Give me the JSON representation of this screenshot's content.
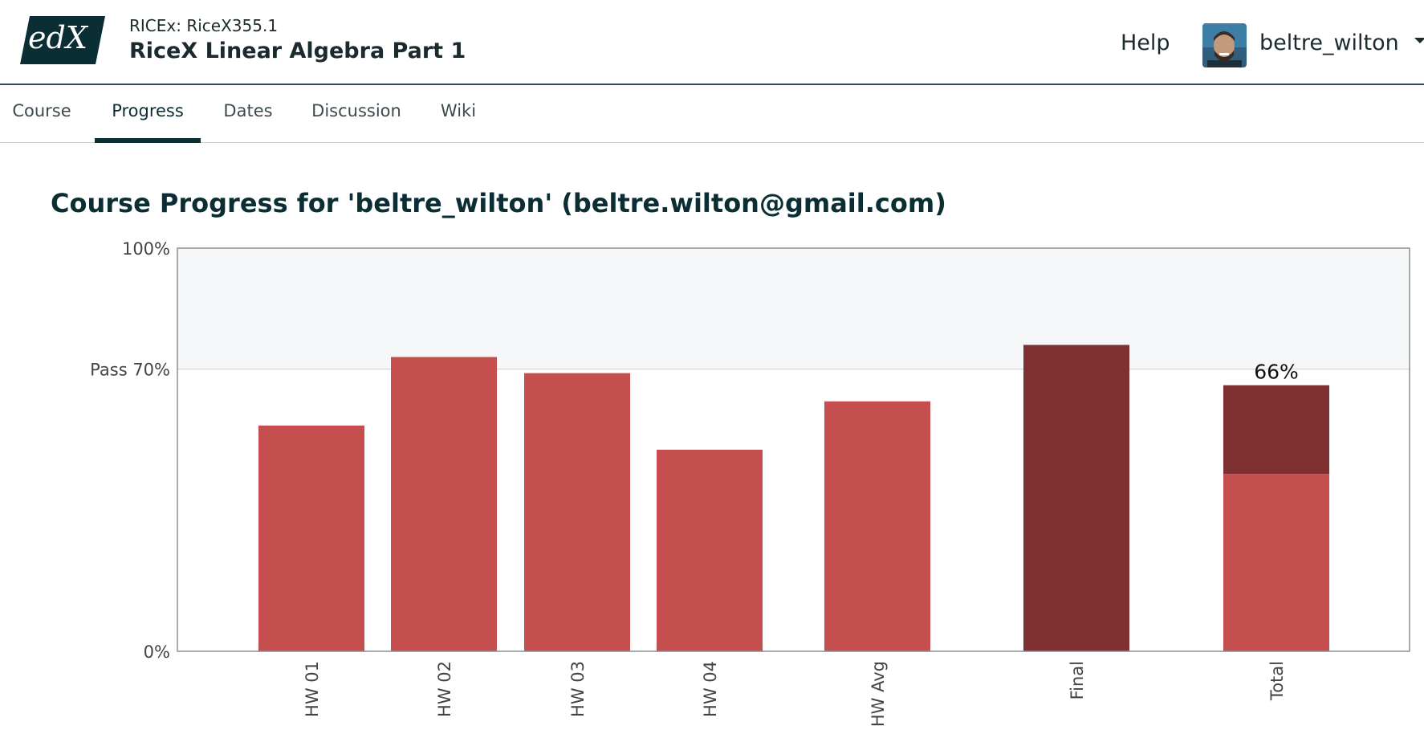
{
  "course": {
    "org_line": "RICEx: RiceX355.1",
    "title": "RiceX Linear Algebra Part 1"
  },
  "header": {
    "logo_text": "edX",
    "help_label": "Help",
    "username": "beltre_wilton"
  },
  "tabs": [
    {
      "label": "Course",
      "active": false
    },
    {
      "label": "Progress",
      "active": true
    },
    {
      "label": "Dates",
      "active": false
    },
    {
      "label": "Discussion",
      "active": false
    },
    {
      "label": "Wiki",
      "active": false
    }
  ],
  "page_title": "Course Progress for 'beltre_wilton' (beltre.wilton@gmail.com)",
  "colors": {
    "brand_dark": "#0a2e33",
    "bar_assignment": "#c54e4f",
    "bar_final": "#7f3131",
    "plot_band": "#f6f7f9",
    "pass_line": "#dddddd"
  },
  "chart_data": {
    "type": "bar",
    "categories": [
      "HW 01",
      "HW 02",
      "HW 03",
      "HW 04",
      "HW Avg",
      "Final",
      "Total"
    ],
    "values": [
      56,
      73,
      69,
      50,
      62,
      76,
      66
    ],
    "total_breakdown": {
      "homework_portion": 44,
      "final_portion": 22
    },
    "total_label": "66%",
    "ylim": [
      0,
      100
    ],
    "y_ticks": [
      {
        "value": 100,
        "label": "100%"
      },
      {
        "value": 70,
        "label": "Pass 70%"
      },
      {
        "value": 0,
        "label": "0%"
      }
    ],
    "pass_threshold": 70
  }
}
